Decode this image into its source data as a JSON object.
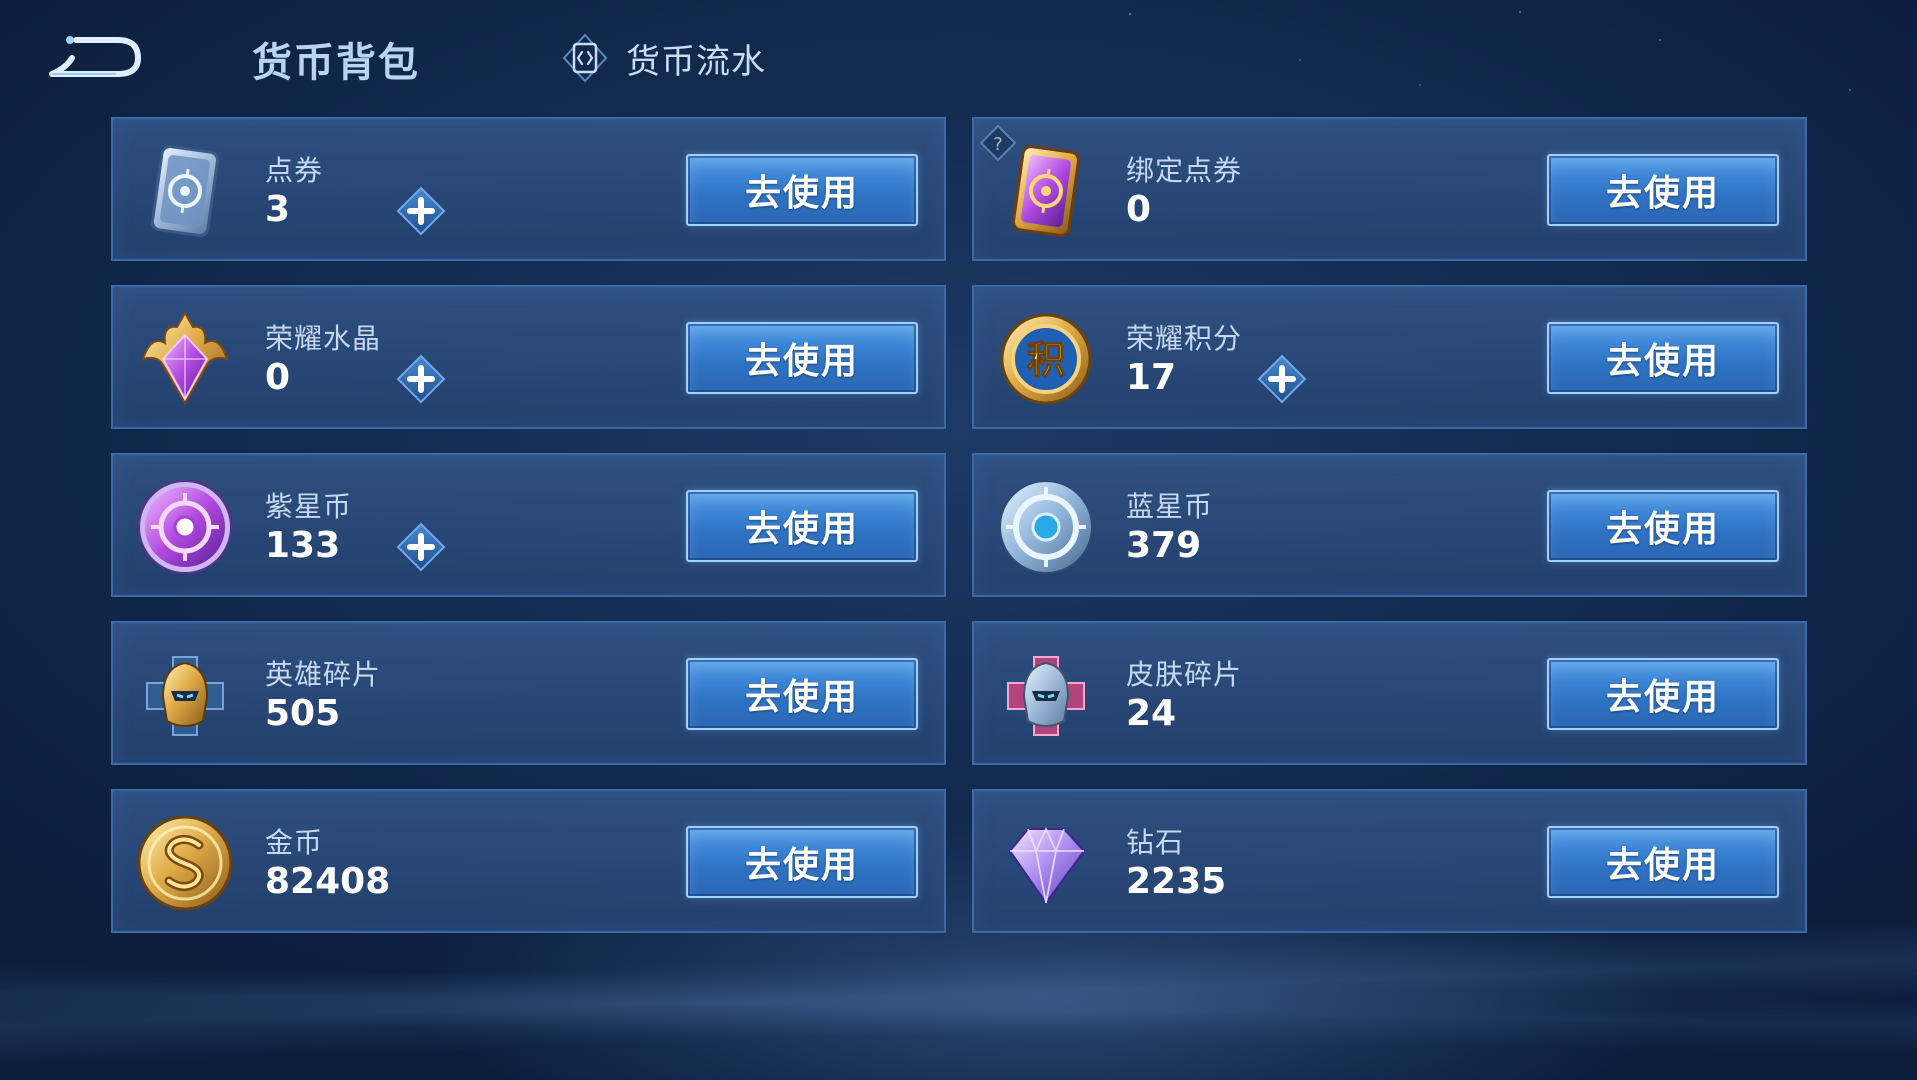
{
  "header": {
    "title": "货币背包",
    "history_tab_label": "货币流水"
  },
  "colors": {
    "card_bg": "#2f5487",
    "card_border": "#3d6aa6",
    "button_blue": "#3a86d8",
    "title_text": "#b9d3f4"
  },
  "currencies": [
    {
      "name": "点券",
      "amount": "3",
      "icon": "coupon-card-icon",
      "button_label": "去使用",
      "has_plus": true
    },
    {
      "name": "绑定点券",
      "amount": "0",
      "icon": "bound-coupon-card-icon",
      "button_label": "去使用",
      "has_plus": false,
      "has_help": true
    },
    {
      "name": "荣耀水晶",
      "amount": "0",
      "icon": "glory-crystal-icon",
      "button_label": "去使用",
      "has_plus": true
    },
    {
      "name": "荣耀积分",
      "amount": "17",
      "icon": "glory-points-coin-icon",
      "button_label": "去使用",
      "has_plus": true
    },
    {
      "name": "紫星币",
      "amount": "133",
      "icon": "purple-star-coin-icon",
      "button_label": "去使用",
      "has_plus": true
    },
    {
      "name": "蓝星币",
      "amount": "379",
      "icon": "blue-star-coin-icon",
      "button_label": "去使用",
      "has_plus": false
    },
    {
      "name": "英雄碎片",
      "amount": "505",
      "icon": "hero-fragment-icon",
      "button_label": "去使用",
      "has_plus": false
    },
    {
      "name": "皮肤碎片",
      "amount": "24",
      "icon": "skin-fragment-icon",
      "button_label": "去使用",
      "has_plus": false
    },
    {
      "name": "金币",
      "amount": "82408",
      "icon": "gold-coin-icon",
      "button_label": "去使用",
      "has_plus": false
    },
    {
      "name": "钻石",
      "amount": "2235",
      "icon": "diamond-icon",
      "button_label": "去使用",
      "has_plus": false
    }
  ],
  "icon_glyphs": {
    "points_char": "积",
    "help_char": "?"
  }
}
